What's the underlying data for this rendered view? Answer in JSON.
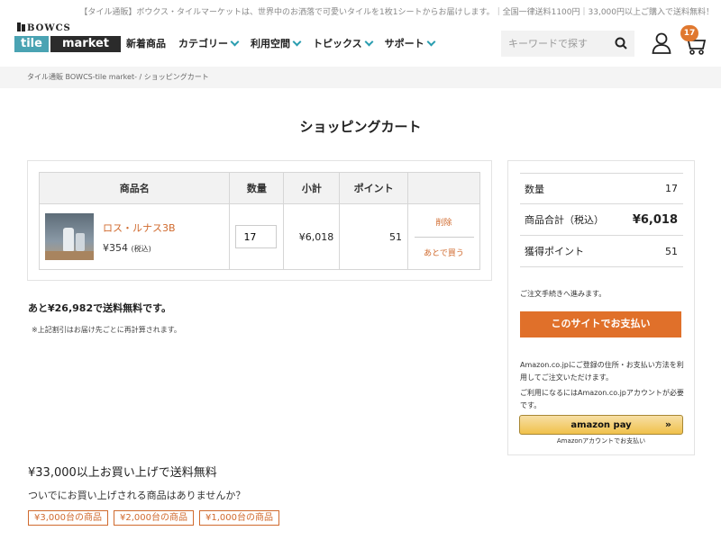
{
  "header": {
    "announcement": "【タイル通販】ボウクス・タイルマーケットは、世界中のお洒落で可愛いタイルを1枚1シートからお届けします。｜全国一律送料1100円｜33,000円以上ご購入で送料無料！",
    "logo": {
      "brand": "BOWCS",
      "tile": "tile",
      "market": "market"
    },
    "nav": [
      {
        "label": "新着商品",
        "dropdown": false
      },
      {
        "label": "カテゴリー",
        "dropdown": true
      },
      {
        "label": "利用空間",
        "dropdown": true
      },
      {
        "label": "トピックス",
        "dropdown": true
      },
      {
        "label": "サポート",
        "dropdown": true
      }
    ],
    "search": {
      "placeholder": "キーワードで探す",
      "value": ""
    },
    "cart_count": "17"
  },
  "breadcrumb": "タイル通販 BOWCS-tile market- / ショッピングカート",
  "page_title": "ショッピングカート",
  "cart": {
    "columns": [
      "商品名",
      "数量",
      "小計",
      "ポイント",
      ""
    ],
    "items": [
      {
        "name": "ロス・ルナス3B",
        "price": "¥354",
        "tax_note": "(税込)",
        "quantity": "17",
        "subtotal": "¥6,018",
        "points": "51",
        "delete_label": "削除",
        "later_label": "あとで買う"
      }
    ]
  },
  "shipping": {
    "remaining": "あと¥26,982で送料無料です。",
    "note": "※上記割引はお届け先ごとに再計算されます。"
  },
  "summary": {
    "rows": [
      {
        "label": "数量",
        "value": "17"
      },
      {
        "label": "商品合計（税込）",
        "value": "¥6,018"
      },
      {
        "label": "獲得ポイント",
        "value": "51"
      }
    ],
    "proceed_text": "ご注文手続きへ進みます。",
    "pay_button": "このサイトでお支払い",
    "amazon_text1": "Amazon.co.jpにご登録の住所・お支払い方法を利用してご注文いただけます。",
    "amazon_text2": "ご利用になるにはAmazon.co.jpアカウントが必要です。",
    "amazon_button": "amazon pay",
    "amazon_sub": "Amazonアカウントでお支払い"
  },
  "promo": {
    "title": "¥33,000以上お買い上げで送料無料",
    "question": "ついでにお買い上げされる商品はありませんか？",
    "tags": [
      "¥3,000台の商品",
      "¥2,000台の商品",
      "¥1,000台の商品"
    ]
  },
  "colors": {
    "accent": "#e0702a",
    "link": "#d06a2e",
    "teal": "#4aa3b3"
  }
}
